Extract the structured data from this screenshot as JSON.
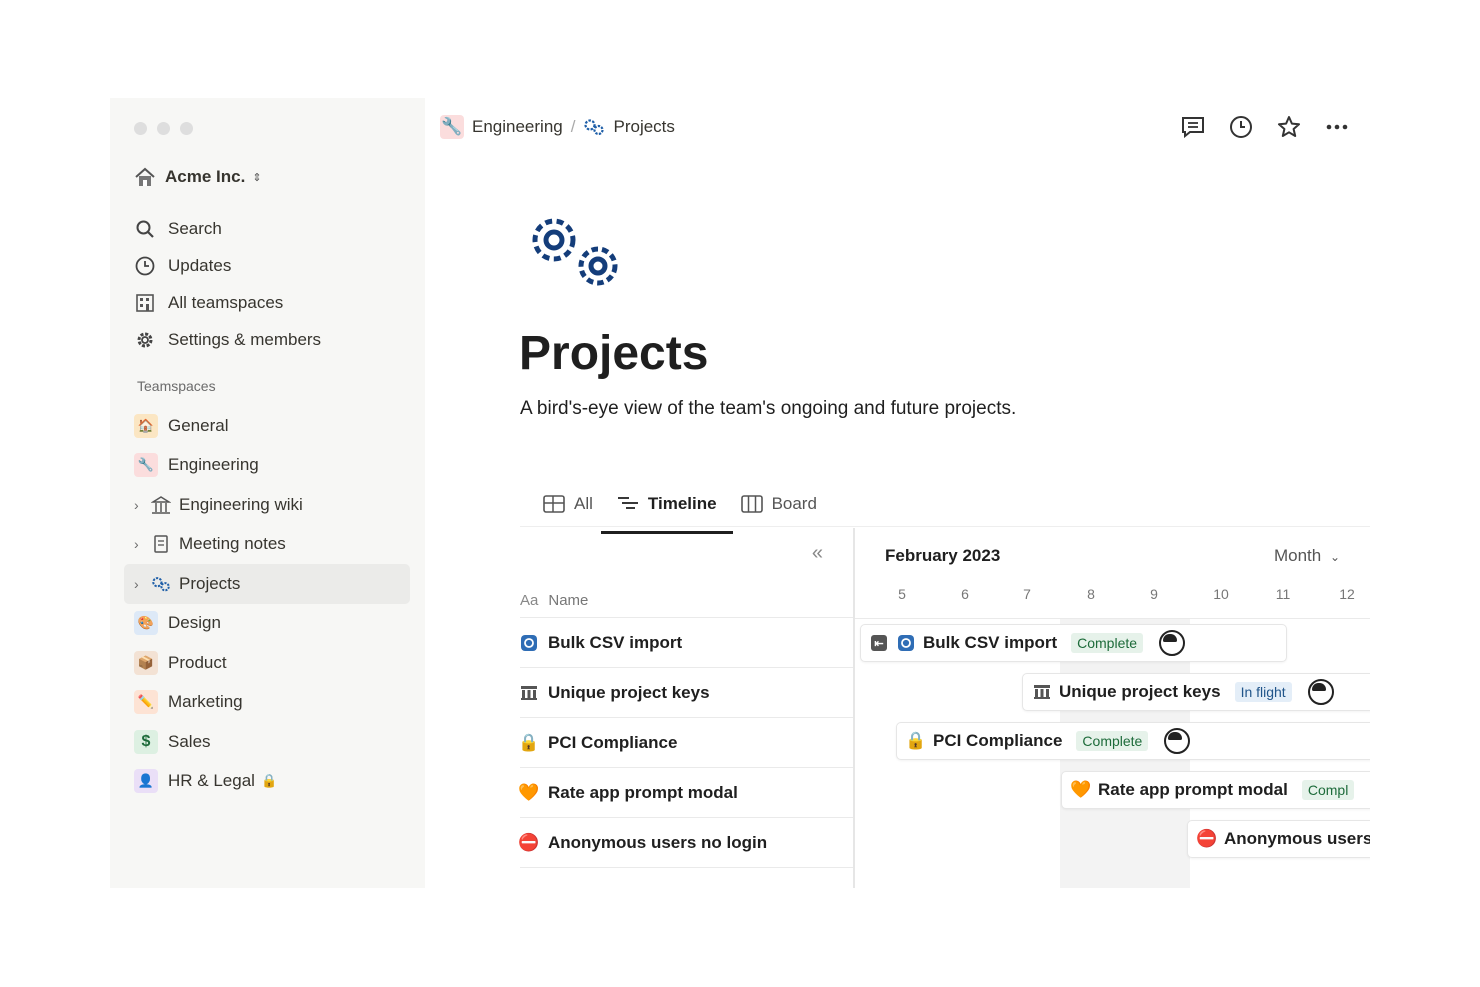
{
  "workspace": {
    "name": "Acme Inc."
  },
  "nav": [
    {
      "label": "Search",
      "icon": "search-icon"
    },
    {
      "label": "Updates",
      "icon": "clock-icon"
    },
    {
      "label": "All teamspaces",
      "icon": "building-icon"
    },
    {
      "label": "Settings & members",
      "icon": "gear-icon"
    }
  ],
  "teamspaces_label": "Teamspaces",
  "teamspaces": [
    {
      "label": "General",
      "icon": "house-icon",
      "color": "#fbe6c3"
    },
    {
      "label": "Engineering",
      "icon": "wrench-icon",
      "color": "#fbdddd"
    },
    {
      "label": "Engineering wiki",
      "icon": "library-icon"
    },
    {
      "label": "Meeting notes",
      "icon": "notebook-icon"
    },
    {
      "label": "Projects",
      "icon": "gears-icon"
    },
    {
      "label": "Design",
      "icon": "palette-icon",
      "color": "#dde9f7"
    },
    {
      "label": "Product",
      "icon": "box-icon",
      "color": "#f3e2d4"
    },
    {
      "label": "Marketing",
      "icon": "pencil-icon",
      "color": "#fde3d4"
    },
    {
      "label": "Sales",
      "icon": "dollar-icon",
      "color": "#ddf0e2"
    },
    {
      "label": "HR & Legal",
      "icon": "person-icon",
      "color": "#eadff7"
    }
  ],
  "breadcrumb": {
    "parent": "Engineering",
    "current": "Projects"
  },
  "page": {
    "title": "Projects",
    "description": "A bird's-eye view of the team's ongoing and future projects."
  },
  "views": [
    {
      "label": "All"
    },
    {
      "label": "Timeline"
    },
    {
      "label": "Board"
    }
  ],
  "table": {
    "name_header": "Name",
    "name_header_prefix": "Aa",
    "rows": [
      {
        "name": "Bulk CSV import",
        "icon": "import-icon"
      },
      {
        "name": "Unique project keys",
        "icon": "columns-icon"
      },
      {
        "name": "PCI Compliance",
        "icon": "lock-icon"
      },
      {
        "name": "Rate app prompt modal",
        "icon": "heart-icon"
      },
      {
        "name": "Anonymous users no login",
        "icon": "no-entry-icon"
      }
    ]
  },
  "timeline": {
    "month_label": "February 2023",
    "scale_label": "Month",
    "days": [
      "5",
      "6",
      "7",
      "8",
      "9",
      "10",
      "11",
      "12"
    ],
    "bars": [
      {
        "name": "Bulk CSV import",
        "status": "Complete"
      },
      {
        "name": "Unique project keys",
        "status": "In flight"
      },
      {
        "name": "PCI Compliance",
        "status": "Complete"
      },
      {
        "name": "Rate app prompt modal",
        "status": "Compl"
      },
      {
        "name": "Anonymous users",
        "status": ""
      }
    ]
  }
}
